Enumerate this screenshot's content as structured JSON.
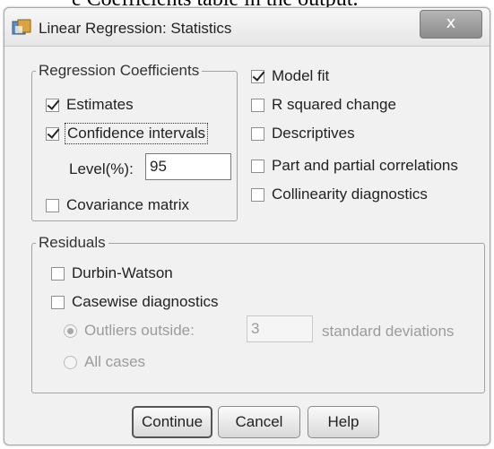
{
  "caption": "e Coefficients table in the output.",
  "window": {
    "title": "Linear Regression: Statistics",
    "close_label": "x",
    "icon": "spss-app-icon"
  },
  "regression_coefficients": {
    "legend": "Regression Coefficients",
    "estimates": {
      "label": "Estimates",
      "checked": true
    },
    "confidence_intervals": {
      "label": "Confidence intervals",
      "checked": true
    },
    "level_label": "Level(%):",
    "level_value": "95",
    "covariance_matrix": {
      "label": "Covariance matrix",
      "checked": false
    }
  },
  "right_options": {
    "model_fit": {
      "label": "Model fit",
      "checked": true
    },
    "r_squared_change": {
      "label": "R squared change",
      "checked": false
    },
    "descriptives": {
      "label": "Descriptives",
      "checked": false
    },
    "part_partial": {
      "label": "Part and partial correlations",
      "checked": false
    },
    "collinearity": {
      "label": "Collinearity diagnostics",
      "checked": false
    }
  },
  "residuals": {
    "legend": "Residuals",
    "durbin_watson": {
      "label": "Durbin-Watson",
      "checked": false
    },
    "casewise": {
      "label": "Casewise diagnostics",
      "checked": false
    },
    "outliers_outside": {
      "label": "Outliers outside:",
      "selected": true
    },
    "outliers_value": "3",
    "std_dev_label": "standard deviations",
    "all_cases": {
      "label": "All cases",
      "selected": false
    }
  },
  "buttons": {
    "continue": "Continue",
    "cancel": "Cancel",
    "help": "Help"
  }
}
